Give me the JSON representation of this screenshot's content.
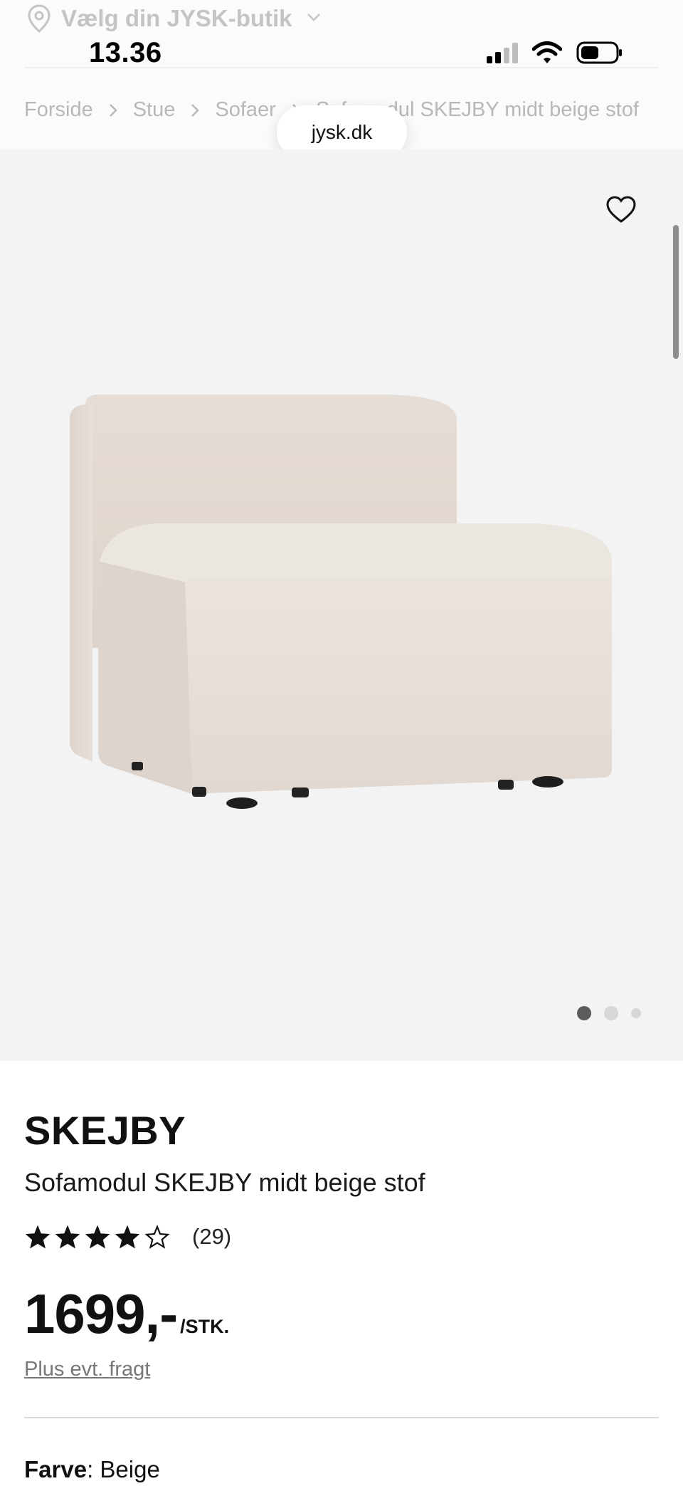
{
  "store_selector": {
    "label": "Vælg din JYSK-butik"
  },
  "status_bar": {
    "time": "13.36"
  },
  "breadcrumb": [
    "Forside",
    "Stue",
    "Sofaer",
    "Sofamodul SKEJBY midt beige stof"
  ],
  "url_pill": "jysk.dk",
  "gallery": {
    "total_images": 3,
    "active_index": 0
  },
  "product": {
    "brand": "SKEJBY",
    "name": "Sofamodul SKEJBY midt beige stof",
    "rating": 4,
    "rating_max": 5,
    "rating_count": "(29)",
    "price": "1699,-",
    "unit": "/STK.",
    "freight_link": "Plus evt. fragt",
    "color_label": "Farve",
    "color_separator": ":",
    "color_value": " Beige"
  },
  "colors": {
    "accent_text": "#111111",
    "muted_text": "#b8b8b8",
    "gallery_bg": "#f3f3f3",
    "sofa_fabric": "#e9e2dc"
  }
}
